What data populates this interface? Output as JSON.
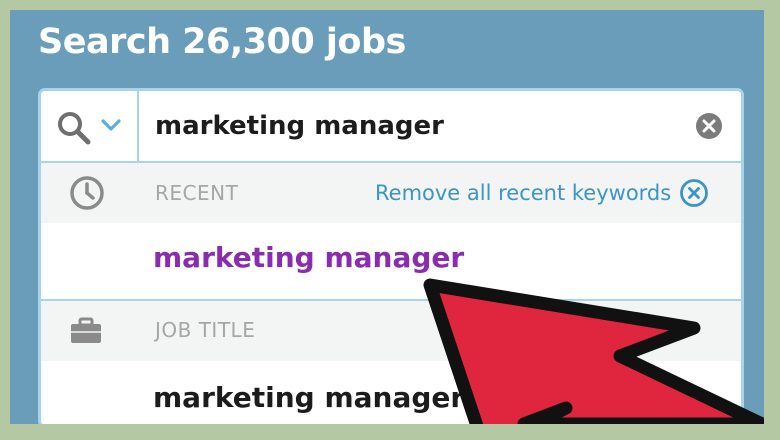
{
  "header": {
    "title": "Search 26,300 jobs"
  },
  "search": {
    "query": "marketing manager",
    "type_icon": "search-icon",
    "dropdown_icon": "chevron-down-icon",
    "clear_icon": "clear-icon"
  },
  "suggestions": {
    "recent": {
      "icon": "clock-icon",
      "label": "RECENT",
      "remove_all_label": "Remove all recent keywords",
      "remove_icon": "close-circle-icon",
      "items": [
        "marketing manager"
      ]
    },
    "job_title": {
      "icon": "briefcase-icon",
      "label": "JOB TITLE",
      "items": [
        "marketing manager"
      ]
    }
  },
  "colors": {
    "panel": "#6a9dba",
    "frame": "#b3c8a3",
    "border": "#a7d3ec",
    "link": "#3c95c4",
    "visited": "#8a2cb0",
    "arrow": "#e0263f"
  }
}
